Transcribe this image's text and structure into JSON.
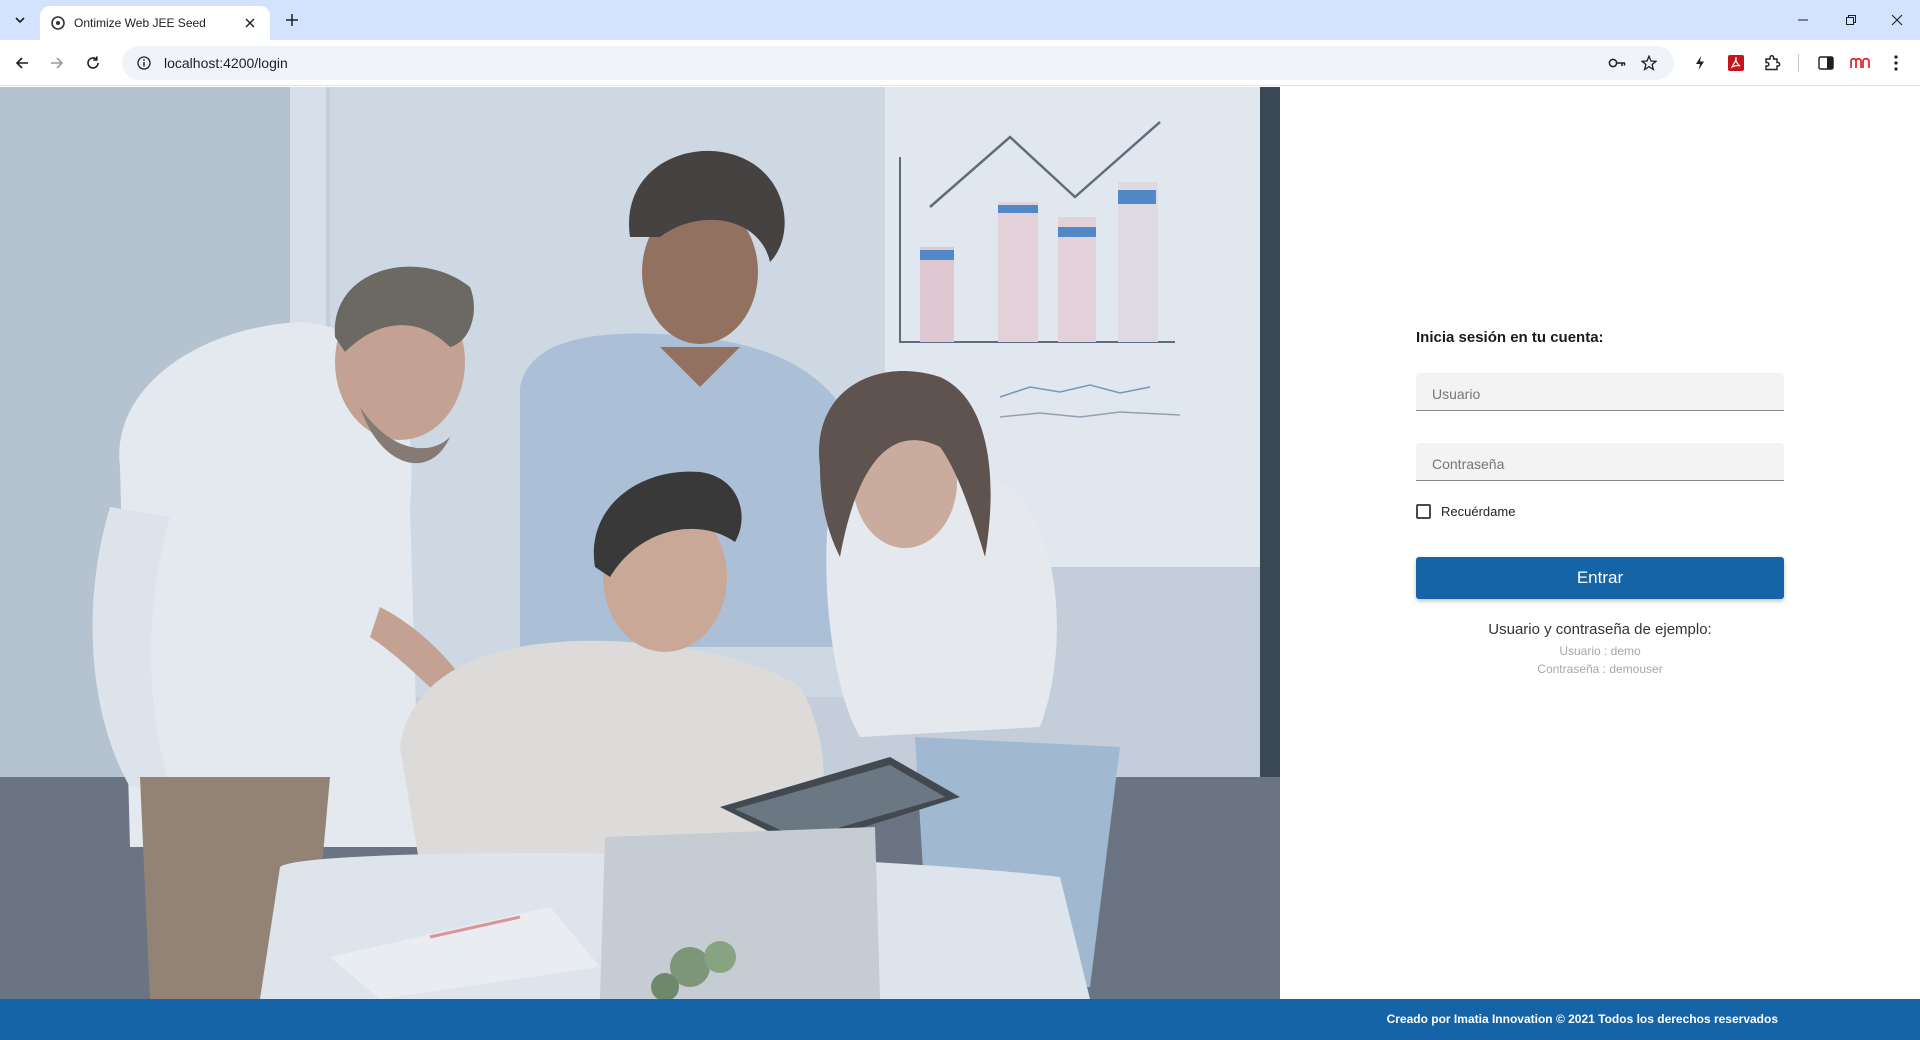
{
  "browser": {
    "tab_title": "Ontimize Web JEE Seed",
    "url": "localhost:4200/login"
  },
  "login": {
    "title": "Inicia sesión en tu cuenta:",
    "username_placeholder": "Usuario",
    "password_placeholder": "Contraseña",
    "remember_label": "Recuérdame",
    "submit_label": "Entrar",
    "demo_title": "Usuario y contraseña de ejemplo:",
    "demo_user": "Usuario : demo",
    "demo_password": "Contraseña : demouser"
  },
  "footer": {
    "text": "Creado por Imatia Innovation © 2021 Todos los derechos reservados"
  },
  "colors": {
    "brand_blue": "#1664a8",
    "tabstrip": "#d3e3fd"
  }
}
